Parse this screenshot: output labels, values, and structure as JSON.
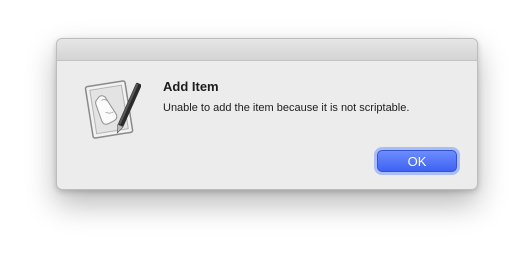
{
  "dialog": {
    "heading": "Add Item",
    "message": "Unable to add the item because it is not scriptable.",
    "ok_label": "OK",
    "icon": "script-editor-icon"
  },
  "colors": {
    "accent": "#4a6cf7"
  }
}
